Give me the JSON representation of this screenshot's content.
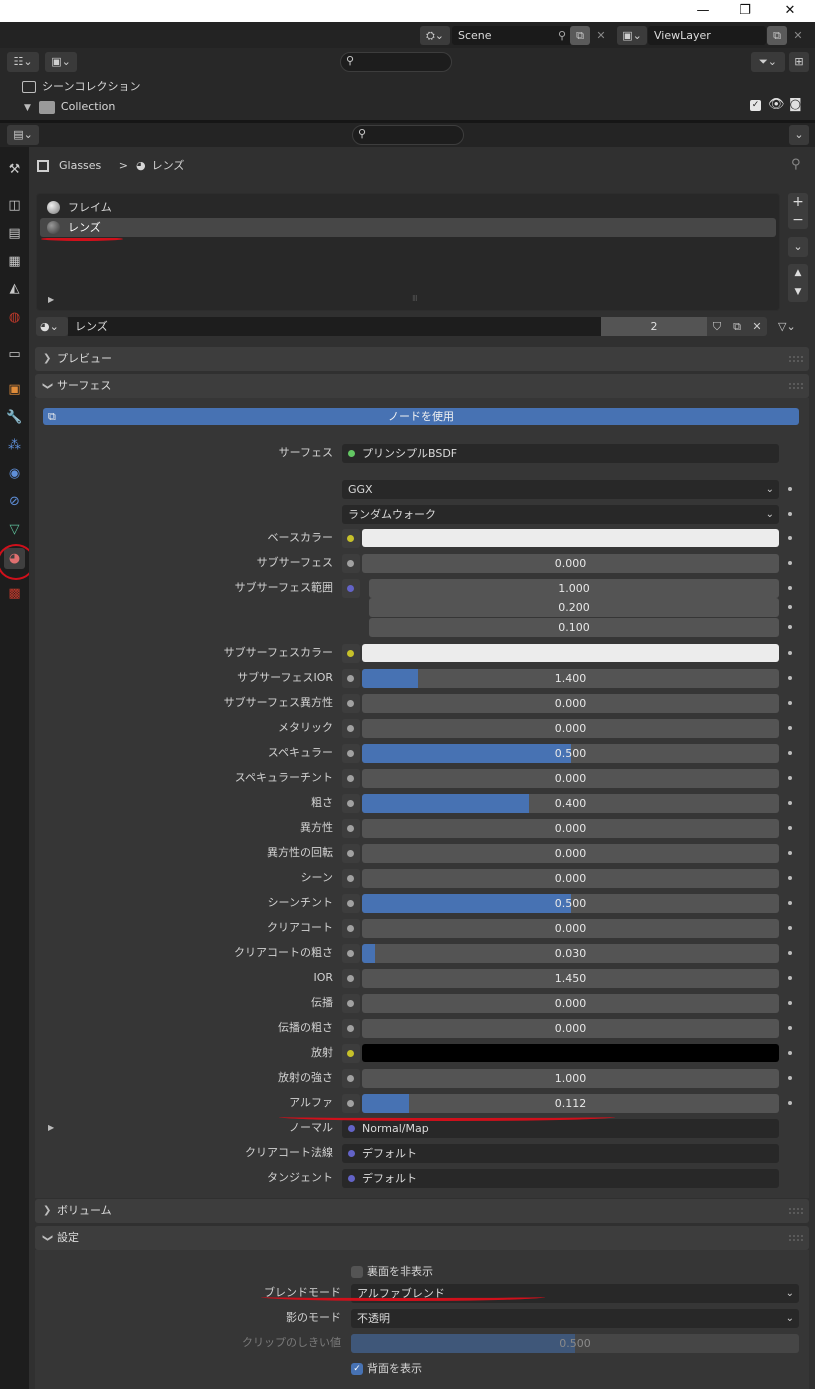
{
  "window": {
    "minimize": "—",
    "maximize": "❐",
    "close": "✕"
  },
  "topbar": {
    "scene": "Scene",
    "view_layer": "ViewLayer"
  },
  "outliner": {
    "scene_collection": "シーンコレクション",
    "collection": "Collection"
  },
  "breadcrumb": {
    "object": "Glasses",
    "separator": ">",
    "material": "レンズ"
  },
  "material_slots": [
    "フレイム",
    "レンズ"
  ],
  "material_selector": {
    "name": "レンズ",
    "users": "2"
  },
  "panels": {
    "preview": "プレビュー",
    "surface": "サーフェス",
    "volume": "ボリューム",
    "settings": "設定"
  },
  "use_nodes_label": "ノードを使用",
  "surface_shader": {
    "label": "サーフェス",
    "value": "プリンシプルBSDF"
  },
  "distribution": "GGX",
  "subsurface_method": "ランダムウォーク",
  "props": {
    "base_color": "ベースカラー",
    "subsurface": "サブサーフェス",
    "subsurface_value": "0.000",
    "subsurface_radius": "サブサーフェス範囲",
    "radius_1": "1.000",
    "radius_2": "0.200",
    "radius_3": "0.100",
    "subsurface_color": "サブサーフェスカラー",
    "subsurface_ior": "サブサーフェスIOR",
    "subsurface_ior_value": "1.400",
    "subsurface_aniso": "サブサーフェス異方性",
    "subsurface_aniso_value": "0.000",
    "metallic": "メタリック",
    "metallic_value": "0.000",
    "specular": "スペキュラー",
    "specular_value": "0.500",
    "specular_tint": "スペキュラーチント",
    "specular_tint_value": "0.000",
    "roughness": "粗さ",
    "roughness_value": "0.400",
    "anisotropic": "異方性",
    "anisotropic_value": "0.000",
    "aniso_rotation": "異方性の回転",
    "aniso_rotation_value": "0.000",
    "sheen": "シーン",
    "sheen_value": "0.000",
    "sheen_tint": "シーンチント",
    "sheen_tint_value": "0.500",
    "clearcoat": "クリアコート",
    "clearcoat_value": "0.000",
    "clearcoat_roughness": "クリアコートの粗さ",
    "clearcoat_roughness_value": "0.030",
    "ior": "IOR",
    "ior_value": "1.450",
    "transmission": "伝播",
    "transmission_value": "0.000",
    "transmission_roughness": "伝播の粗さ",
    "transmission_roughness_value": "0.000",
    "emission": "放射",
    "emission_strength": "放射の強さ",
    "emission_strength_value": "1.000",
    "alpha": "アルファ",
    "alpha_value": "0.112",
    "normal": "ノーマル",
    "normal_value": "Normal/Map",
    "clearcoat_normal": "クリアコート法線",
    "clearcoat_normal_value": "デフォルト",
    "tangent": "タンジェント",
    "tangent_value": "デフォルト"
  },
  "settings": {
    "backface_culling": "裏面を非表示",
    "blend_mode_label": "ブレンドモード",
    "blend_mode": "アルファブレンド",
    "shadow_mode_label": "影のモード",
    "shadow_mode": "不透明",
    "clip_threshold_label": "クリップのしきい値",
    "clip_threshold": "0.500",
    "show_backface": "背面を表示"
  },
  "fills": {
    "subsurface_ior": 0.135,
    "specular": 0.5,
    "roughness": 0.4,
    "clearcoat_roughness": 0.03,
    "alpha": 0.112,
    "sheen_tint": 0.5
  },
  "colors": {
    "accent": "#4772b3",
    "annotation": "#d0101b",
    "socket_color": "#c7c12a",
    "socket_float": "#a1a1a1",
    "socket_vector": "#6363c7",
    "socket_shader": "#63c763"
  }
}
